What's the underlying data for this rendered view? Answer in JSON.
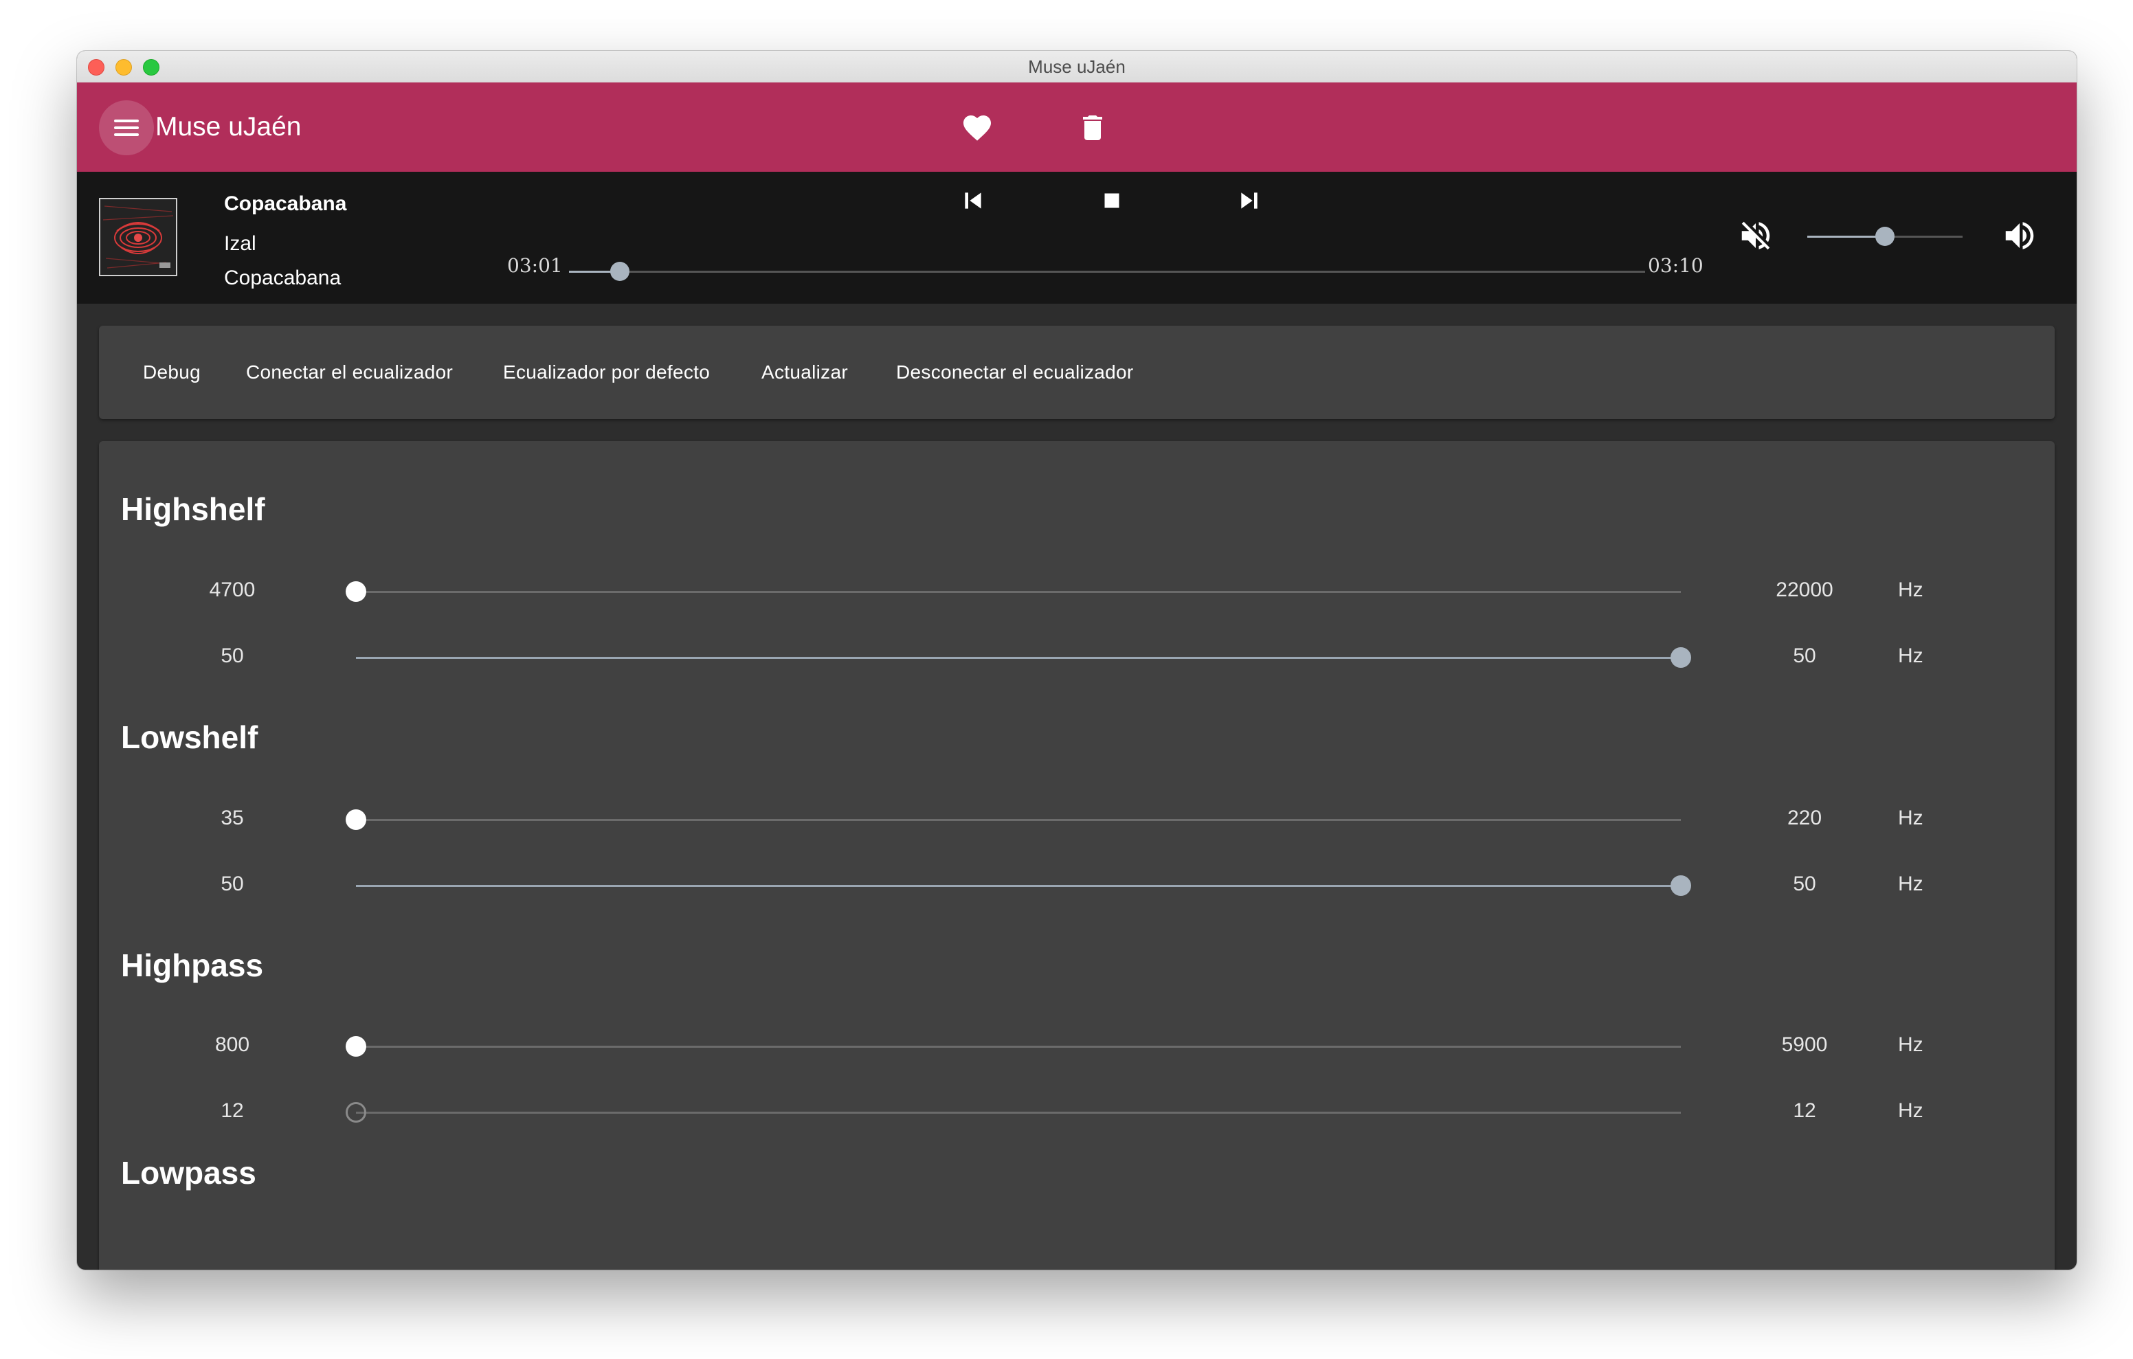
{
  "window": {
    "title": "Muse uJaén"
  },
  "appbar": {
    "title": "Muse uJaén"
  },
  "player": {
    "song_title": "Copacabana",
    "artist": "Izal",
    "album": "Copacabana",
    "elapsed": "03:01",
    "duration": "03:10",
    "progress_fraction": 0.047,
    "volume_fraction": 0.5
  },
  "toolbar": {
    "debug": "Debug",
    "connect": "Conectar el ecualizador",
    "default": "Ecualizador por defecto",
    "update": "Actualizar",
    "disconnect": "Desconectar el ecualizador"
  },
  "sections": [
    {
      "name": "Highshelf",
      "rows": [
        {
          "min": "4700",
          "max": "22000",
          "unit": "Hz",
          "fraction": 0.0
        },
        {
          "min": "50",
          "max": "50",
          "unit": "Hz",
          "fraction": 1.0
        }
      ]
    },
    {
      "name": "Lowshelf",
      "rows": [
        {
          "min": "35",
          "max": "220",
          "unit": "Hz",
          "fraction": 0.0
        },
        {
          "min": "50",
          "max": "50",
          "unit": "Hz",
          "fraction": 1.0
        }
      ]
    },
    {
      "name": "Highpass",
      "rows": [
        {
          "min": "800",
          "max": "5900",
          "unit": "Hz",
          "fraction": 0.0
        },
        {
          "min": "12",
          "max": "12",
          "unit": "Hz",
          "fraction": 0.0
        }
      ]
    },
    {
      "name": "Lowpass",
      "rows": []
    }
  ],
  "colors": {
    "appbar": "#b12e5a",
    "player_bg": "#161616",
    "panel_bg": "#414141",
    "slider_accent": "#a9b4bf"
  },
  "icons": {
    "menu": "menu-icon",
    "favorite": "heart-icon",
    "delete": "trash-icon",
    "previous": "skip-previous-icon",
    "stop": "stop-icon",
    "next": "skip-next-icon",
    "mute": "volume-mute-icon",
    "volume": "volume-up-icon"
  }
}
